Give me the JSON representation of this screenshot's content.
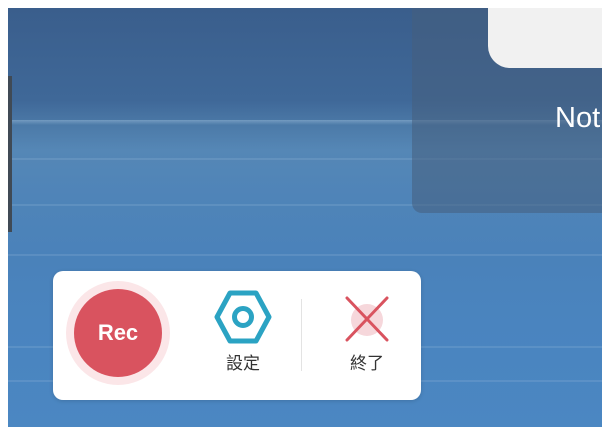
{
  "background": {
    "dialog_text": "Not"
  },
  "toolbar": {
    "rec_label": "Rec",
    "settings_label": "設定",
    "exit_label": "終了",
    "icons": {
      "rec": "record-icon",
      "settings": "hexagon-gear-icon",
      "exit": "close-x-icon"
    }
  },
  "colors": {
    "rec_red": "#d9535f",
    "rec_halo": "#fbe6e8",
    "settings_teal": "#2ba3c3",
    "exit_red": "#d9535f",
    "exit_bg": "#f6d7db",
    "sea_blue": "#4b82ba"
  }
}
